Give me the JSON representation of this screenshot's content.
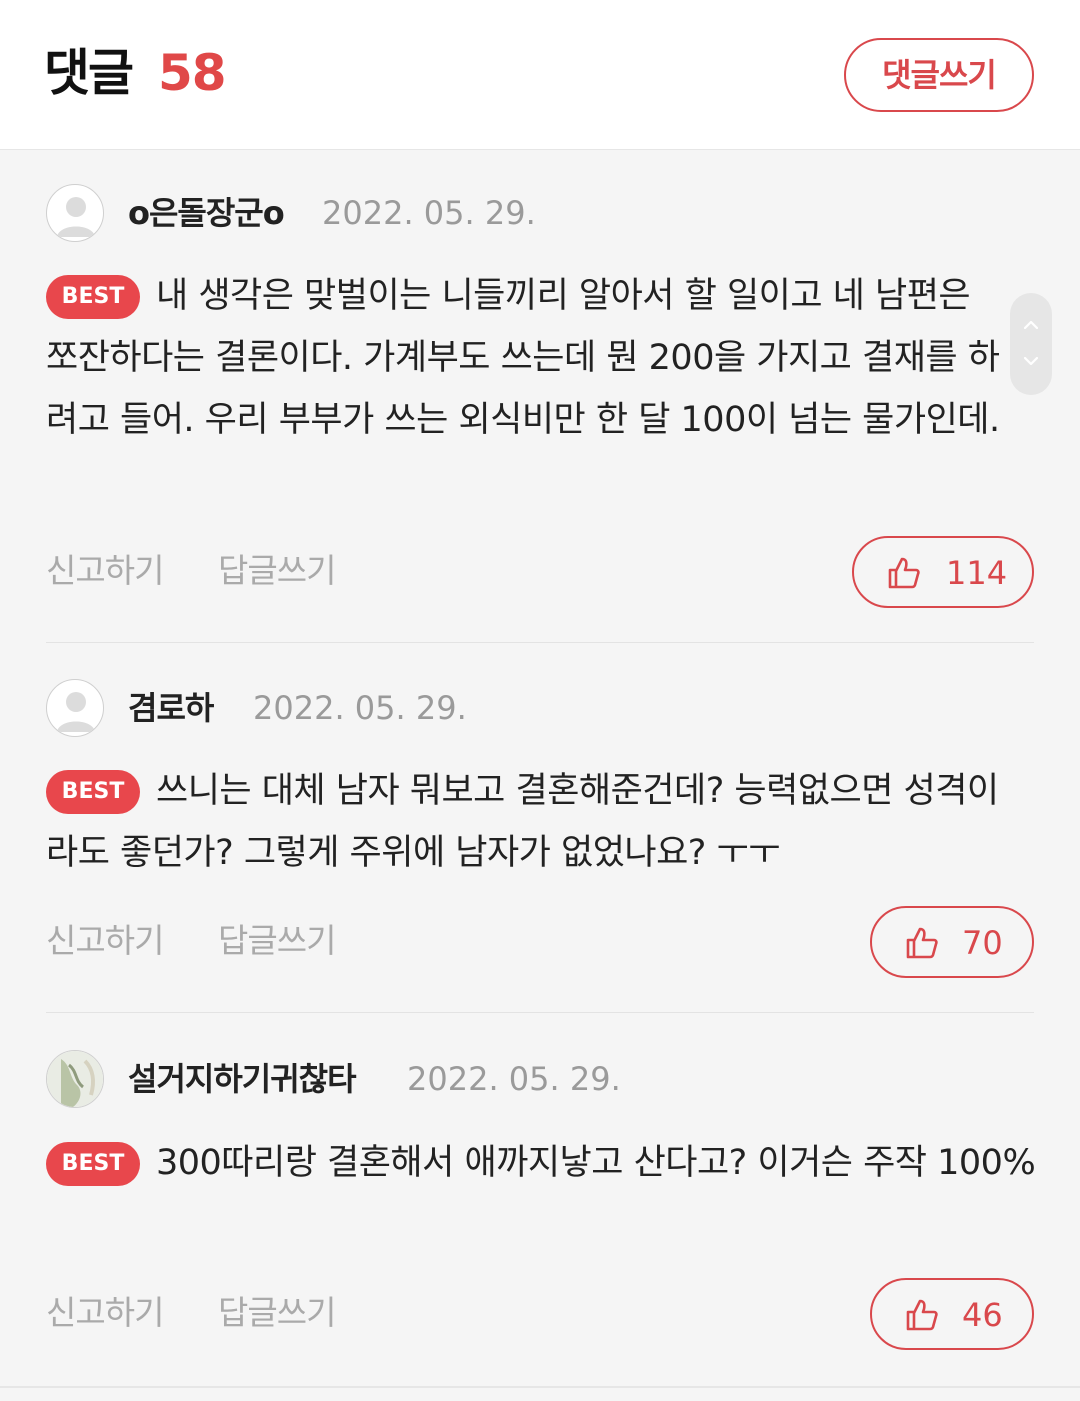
{
  "header": {
    "title": "댓글",
    "count": "58",
    "write_label": "댓글쓰기"
  },
  "colors": {
    "accent": "#e04848",
    "best_badge": "#e8474c",
    "muted_text": "#9a9a9a",
    "background": "#f5f5f5"
  },
  "comments": [
    {
      "nickname": "o은돌장군o",
      "date": "2022. 05. 29.",
      "badge": "BEST",
      "text": "내 생각은 맞벌이는 니들끼리 알아서 할 일이고 네 남편은 쪼잔하다는 결론이다. 가계부도 쓰는데 뭔 200을 가지고 결재를 하려고 들어. 우리 부부가 쓰는 외식비만 한 달 100이 넘는 물가인데.",
      "report_label": "신고하기",
      "reply_label": "답글쓰기",
      "likes": "114",
      "avatar": "default-avatar-icon"
    },
    {
      "nickname": "겸로하",
      "date": "2022. 05. 29.",
      "badge": "BEST",
      "text": "쓰니는 대체 남자 뭐보고 결혼해준건데? 능력없으면 성격이라도 좋던가? 그렇게 주위에 남자가 없었나요? ㅜㅜ",
      "report_label": "신고하기",
      "reply_label": "답글쓰기",
      "likes": "70",
      "avatar": "default-avatar-icon"
    },
    {
      "nickname": "설거지하기귀찮타",
      "date": "2022. 05. 29.",
      "badge": "BEST",
      "text": "300따리랑 결혼해서 애까지낳고 산다고? 이거슨 주작 100%",
      "report_label": "신고하기",
      "reply_label": "답글쓰기",
      "likes": "46",
      "avatar": "photo-avatar"
    }
  ],
  "scroll_handle": {
    "up_icon": "chevron-up-icon",
    "down_icon": "chevron-down-icon"
  }
}
